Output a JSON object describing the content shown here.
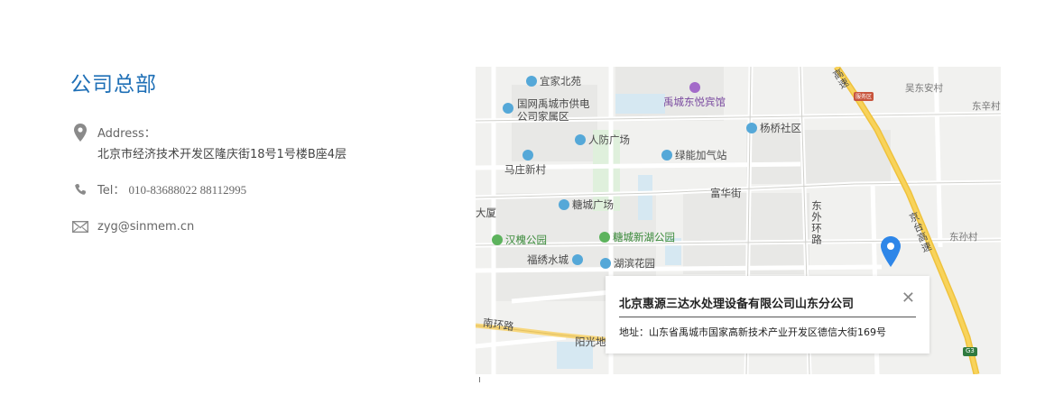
{
  "headquarters": {
    "title": "公司总部",
    "address_label": "Address：",
    "address_value": "北京市经济技术开发区隆庆街18号1号楼B座4层",
    "tel_label": "Tel：",
    "tel_value": "010-83688022  88112995",
    "email": "zyg@sinmem.cn"
  },
  "map": {
    "labels": {
      "yijia": "宜家北苑",
      "yucheng_hotel": "禹城东悦宾馆",
      "guowang": "国网禹城市供电\n公司家属区",
      "yangqiao": "杨桥社区",
      "renfang": "人防广场",
      "lvneng": "绿能加气站",
      "mazhuang": "马庄新村",
      "fuhua": "富华街",
      "tangcheng": "糖城广场",
      "dongwai": "东外环路",
      "hanhuai": "汉槐公园",
      "tangcheng_xinhu": "糖城新湖公园",
      "fuxiu": "福绣水城",
      "hubin": "湖滨花园",
      "nanhuan": "南环路",
      "yangguang": "阳光地",
      "xia": "大厦",
      "wudongan": "吴东安村",
      "dongxin": "东辛村",
      "dongsun": "东孙村",
      "jingtai": "京台高速",
      "gaosu": "高速",
      "service": "服务区",
      "g3": "G3"
    },
    "info": {
      "company": "北京惠源三达水处理设备有限公司山东分公司",
      "address": "地址：山东省禹城市国家高新技术产业开发区德信大街169号",
      "close": "✕"
    }
  }
}
